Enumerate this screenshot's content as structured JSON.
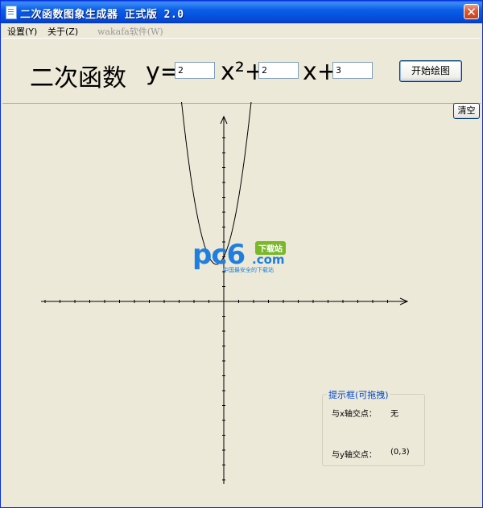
{
  "window": {
    "title": "二次函数图象生成器 正式版 2.0",
    "close_glyph": "✕"
  },
  "menu": {
    "items": [
      "设置(Y)",
      "关于(Z)"
    ],
    "disabled_item": "wakafa软件(W)"
  },
  "equation": {
    "prefix": "二次函数",
    "y_label": "y=",
    "x2_label": "x²+",
    "x_label": "x+",
    "a": "2",
    "b": "2",
    "c": "3"
  },
  "buttons": {
    "draw": "开始绘图",
    "clear": "清空"
  },
  "hint": {
    "title": "提示框(可拖拽)",
    "x_label": "与x轴交点：",
    "x_value": "无",
    "y_label": "与y轴交点：",
    "y_value": "(0,3)"
  },
  "watermark": {
    "logo": "pc6",
    "badge": "下载站",
    "domain": ".com",
    "tagline": "中国最安全的下载站"
  },
  "chart_data": {
    "type": "line",
    "function": "y = 2x² + 2x + 3",
    "coefficients": {
      "a": 2,
      "b": 2,
      "c": 3
    },
    "vertex": [
      -0.5,
      2.5
    ],
    "x_intercepts": [],
    "y_intercept": [
      0,
      3
    ],
    "xlim": [
      -12,
      12
    ],
    "ylim": [
      -12,
      12
    ],
    "tick_step": 1,
    "grid": false,
    "axes_color": "#000000",
    "curve_color": "#000000"
  }
}
